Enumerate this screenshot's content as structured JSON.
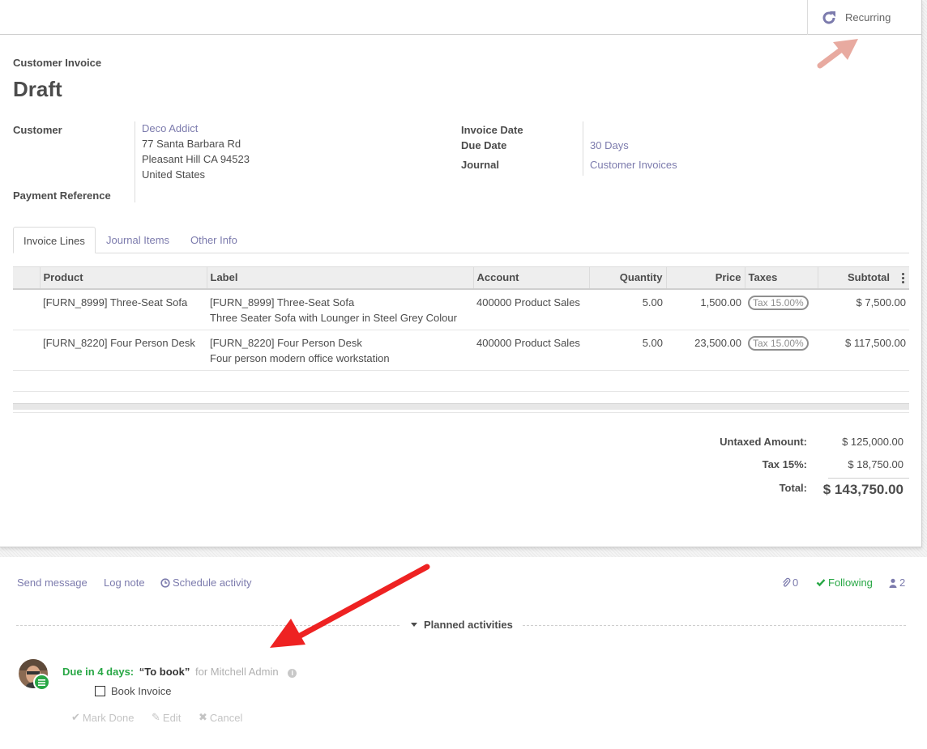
{
  "button_box": {
    "recurring_label": "Recurring"
  },
  "header": {
    "doc_type": "Customer Invoice",
    "state": "Draft"
  },
  "fields": {
    "customer_label": "Customer",
    "customer_name": "Deco Addict",
    "customer_address": [
      "77 Santa Barbara Rd",
      "Pleasant Hill CA 94523",
      "United States"
    ],
    "payment_ref_label": "Payment Reference",
    "invoice_date_label": "Invoice Date",
    "due_date_label": "Due Date",
    "due_date_value": "30 Days",
    "journal_label": "Journal",
    "journal_value": "Customer Invoices"
  },
  "tabs": [
    {
      "label": "Invoice Lines"
    },
    {
      "label": "Journal Items"
    },
    {
      "label": "Other Info"
    }
  ],
  "table": {
    "headers": {
      "product": "Product",
      "label": "Label",
      "account": "Account",
      "quantity": "Quantity",
      "price": "Price",
      "taxes": "Taxes",
      "subtotal": "Subtotal"
    },
    "rows": [
      {
        "product": "[FURN_8999] Three-Seat Sofa",
        "label_1": "[FURN_8999] Three-Seat Sofa",
        "label_2": "Three Seater Sofa with Lounger in Steel Grey Colour",
        "account": "400000 Product Sales",
        "quantity": "5.00",
        "price": "1,500.00",
        "tax": "Tax 15.00%",
        "subtotal": "$ 7,500.00"
      },
      {
        "product": "[FURN_8220] Four Person Desk",
        "label_1": "[FURN_8220] Four Person Desk",
        "label_2": "Four person modern office workstation",
        "account": "400000 Product Sales",
        "quantity": "5.00",
        "price": "23,500.00",
        "tax": "Tax 15.00%",
        "subtotal": "$ 117,500.00"
      }
    ]
  },
  "totals": {
    "untaxed_label": "Untaxed Amount:",
    "untaxed_value": "$ 125,000.00",
    "tax_label": "Tax 15%:",
    "tax_value": "$ 18,750.00",
    "total_label": "Total:",
    "total_value": "$ 143,750.00"
  },
  "chatter": {
    "send_message": "Send message",
    "log_note": "Log note",
    "schedule_activity": "Schedule activity",
    "attachments_count": "0",
    "following": "Following",
    "followers_count": "2",
    "planned_title": "Planned activities",
    "activity": {
      "due": "Due in 4 days:",
      "summary": "“To book”",
      "assignee": "for Mitchell Admin",
      "todo": "Book Invoice",
      "mark_done": "Mark Done",
      "edit": "Edit",
      "cancel": "Cancel"
    }
  },
  "colors": {
    "link": "#7c7bad",
    "success": "#28a745",
    "annotation_arrow": "#ee2222",
    "annotation_arrow_faded": "#e8aaa0"
  }
}
